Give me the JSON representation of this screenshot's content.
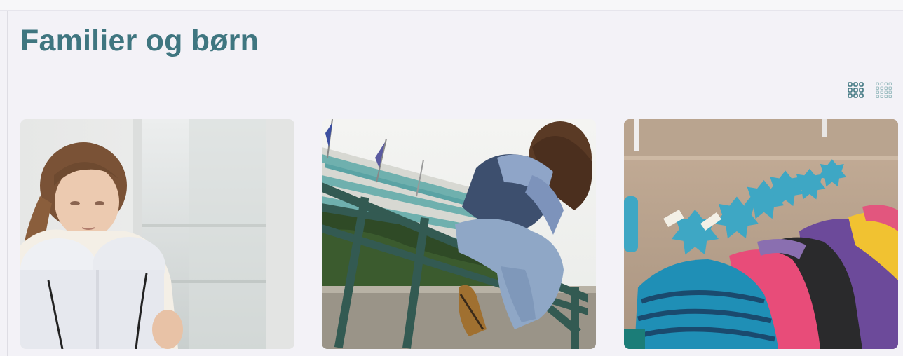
{
  "page": {
    "title": "Familier og børn"
  },
  "view_toggle": {
    "options": [
      {
        "icon": "grid-3x3-icon",
        "active": true
      },
      {
        "icon": "grid-4x4-icon",
        "active": false
      }
    ],
    "accent_color": "#3f7680",
    "inactive_color": "#9fbfc3"
  },
  "cards": [
    {
      "image": "girl-hugging-knees-by-window"
    },
    {
      "image": "teen-sitting-on-railing-head-down"
    },
    {
      "image": "colorful-jackets-on-coat-hooks"
    }
  ]
}
